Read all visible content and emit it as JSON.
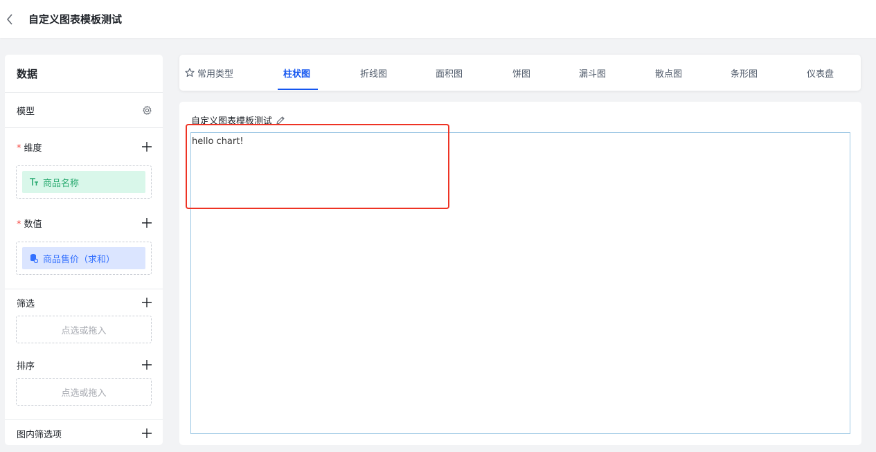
{
  "header": {
    "title": "自定义图表模板测试"
  },
  "sidebar": {
    "title": "数据",
    "model_label": "模型",
    "dimension": {
      "label": "维度",
      "required": "*",
      "chip": "商品名称"
    },
    "measure": {
      "label": "数值",
      "required": "*",
      "chip": "商品售价（求和）"
    },
    "filter": {
      "label": "筛选",
      "placeholder": "点选或拖入"
    },
    "sort": {
      "label": "排序",
      "placeholder": "点选或拖入"
    },
    "inner_filter": {
      "label": "图内筛选项"
    }
  },
  "tabs": [
    {
      "label": "常用类型",
      "icon": "star-icon"
    },
    {
      "label": "柱状图",
      "active": true
    },
    {
      "label": "折线图"
    },
    {
      "label": "面积图"
    },
    {
      "label": "饼图"
    },
    {
      "label": "漏斗图"
    },
    {
      "label": "散点图"
    },
    {
      "label": "条形图"
    },
    {
      "label": "仪表盘"
    }
  ],
  "chart": {
    "title": "自定义图表模板测试",
    "content": "hello chart!"
  },
  "colors": {
    "accent": "#1456f0",
    "dimension_chip": "#d9f7ea",
    "measure_chip": "#dbe5ff",
    "highlight": "#ee3324"
  }
}
